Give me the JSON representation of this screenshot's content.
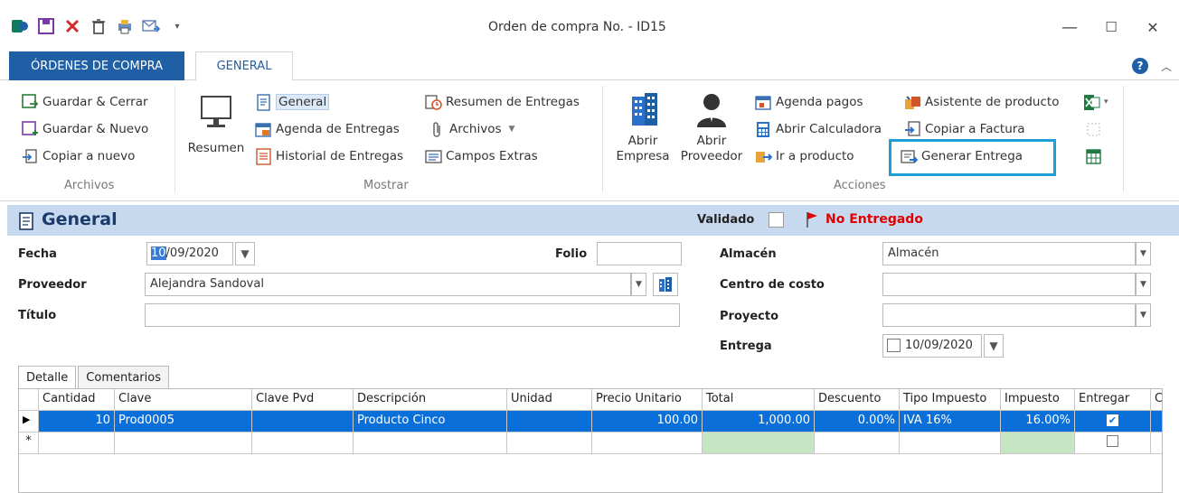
{
  "window": {
    "title": "Orden de compra No. - ID15",
    "minimize": "—",
    "maximize": "☐",
    "close": "✕"
  },
  "ribbon_tabs": {
    "file": "ÓRDENES DE COMPRA",
    "general": "GENERAL"
  },
  "ribbon": {
    "archivos": {
      "guardar_cerrar": "Guardar & Cerrar",
      "guardar_nuevo": "Guardar & Nuevo",
      "copiar_nuevo": "Copiar a nuevo",
      "group": "Archivos"
    },
    "mostrar": {
      "resumen": "Resumen",
      "general": "General",
      "agenda_entregas": "Agenda de Entregas",
      "historial_entregas": "Historial de Entregas",
      "resumen_entregas": "Resumen de Entregas",
      "archivos": "Archivos",
      "campos_extras": "Campos Extras",
      "group": "Mostrar"
    },
    "acciones": {
      "abrir_empresa_1": "Abrir",
      "abrir_empresa_2": "Empresa",
      "abrir_proveedor_1": "Abrir",
      "abrir_proveedor_2": "Proveedor",
      "agenda_pagos": "Agenda pagos",
      "abrir_calculadora": "Abrir Calculadora",
      "ir_producto": "Ir a producto",
      "asistente_producto": "Asistente de producto",
      "copiar_factura": "Copiar a Factura",
      "generar_entrega": "Generar Entrega",
      "group": "Acciones"
    }
  },
  "section": {
    "title": "General",
    "validado_label": "Validado",
    "status": "No Entregado"
  },
  "form": {
    "fecha_label": "Fecha",
    "fecha_day": "10",
    "fecha_rest": "/09/2020",
    "folio_label": "Folio",
    "folio_value": "",
    "proveedor_label": "Proveedor",
    "proveedor_value": "Alejandra Sandoval",
    "titulo_label": "Título",
    "titulo_value": "",
    "almacen_label": "Almacén",
    "almacen_value": "Almacén",
    "centro_costo_label": "Centro de costo",
    "centro_costo_value": "",
    "proyecto_label": "Proyecto",
    "proyecto_value": "",
    "entrega_label": "Entrega",
    "entrega_value": "10/09/2020"
  },
  "grid_tabs": {
    "detalle": "Detalle",
    "comentarios": "Comentarios"
  },
  "grid": {
    "columns": [
      "Cantidad",
      "Clave",
      "Clave Pvd",
      "Descripción",
      "Unidad",
      "Precio Unitario",
      "Total",
      "Descuento",
      "Tipo Impuesto",
      "Impuesto",
      "Entregar",
      "C"
    ],
    "rows": [
      {
        "cantidad": "10",
        "clave": "Prod0005",
        "clave_pvd": "",
        "descripcion": "Producto Cinco",
        "unidad": "",
        "precio_unitario": "100.00",
        "total": "1,000.00",
        "descuento": "0.00%",
        "tipo_impuesto": "IVA 16%",
        "impuesto": "16.00%",
        "entregar": true
      }
    ],
    "new_row_marker": "*",
    "current_row_marker": "▶"
  },
  "colors": {
    "accent": "#1f5fa6",
    "selection": "#0a6fd8",
    "status_red": "#e00000",
    "highlight_box": "#1e9fd8"
  }
}
